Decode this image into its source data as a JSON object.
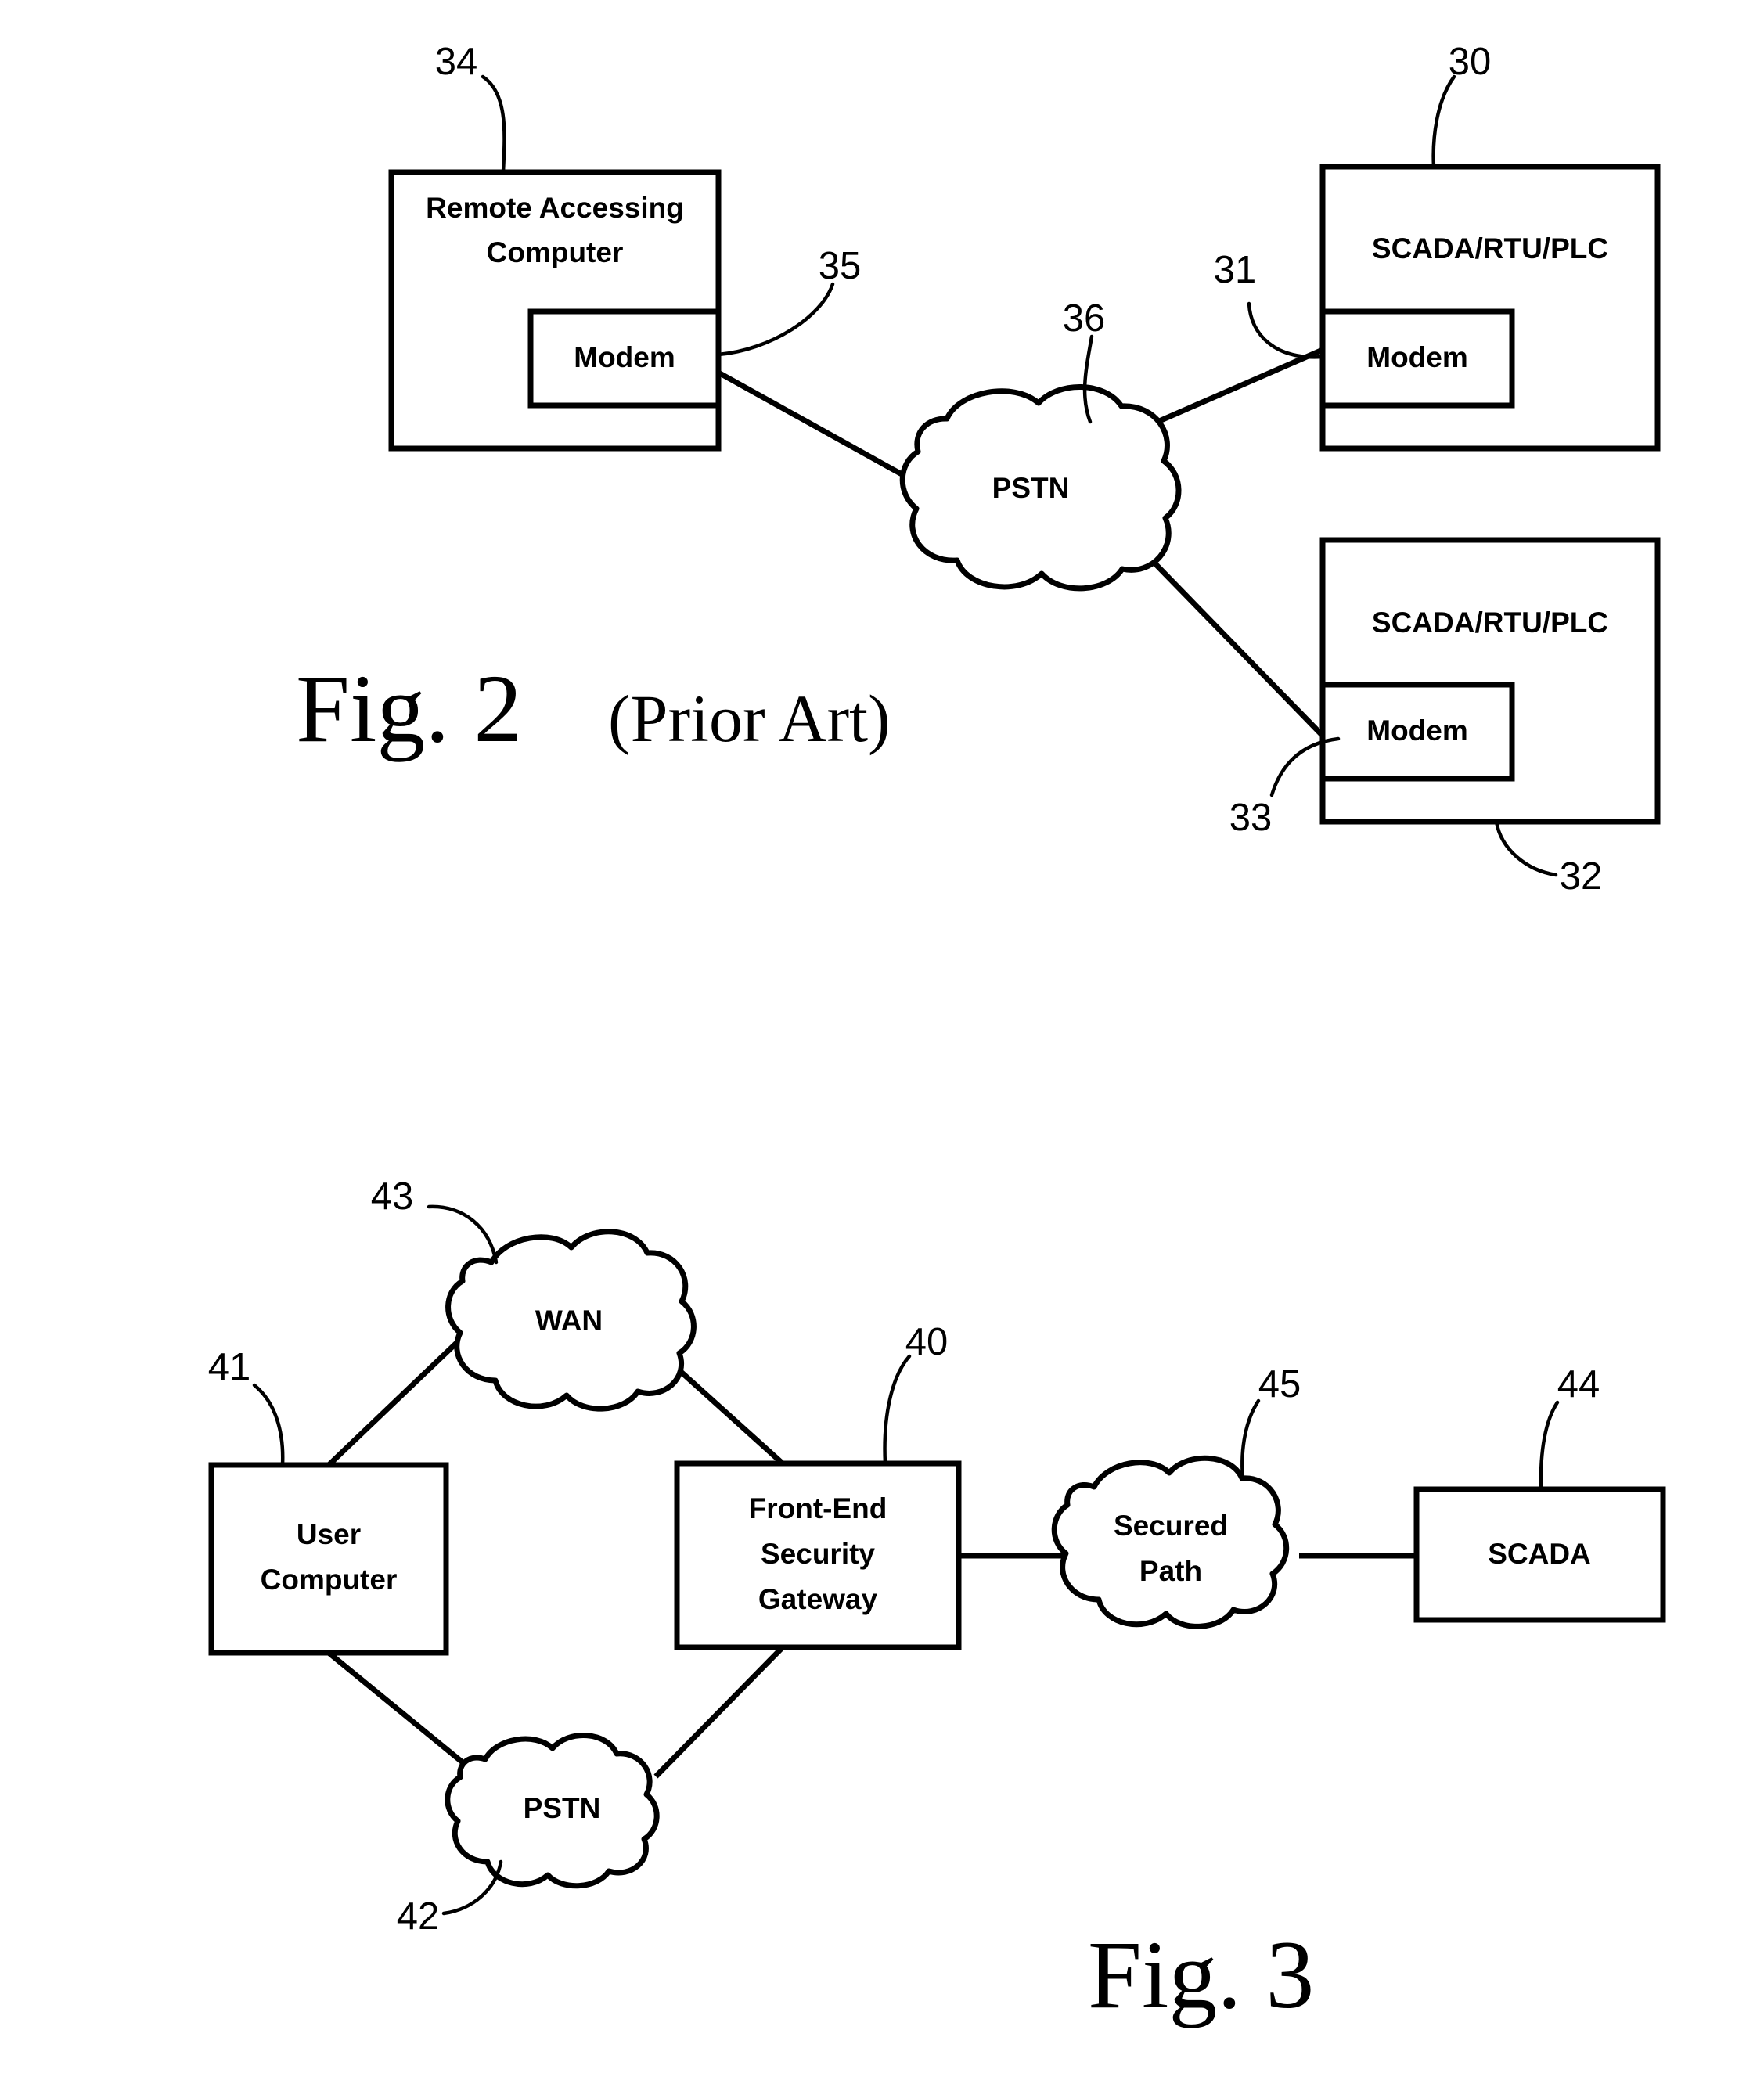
{
  "page": {
    "background": "#ffffff",
    "ink": "#000000"
  },
  "figures": [
    {
      "id": "fig2",
      "caption_main": "Fig. 2",
      "caption_sub": "(Prior Art)",
      "nodes": [
        {
          "id": "remote-accessing-computer",
          "label_line1": "Remote Accessing",
          "label_line2": "Computer",
          "ref": "34",
          "shape": "box"
        },
        {
          "id": "remote-modem",
          "label": "Modem",
          "ref": "35",
          "shape": "box"
        },
        {
          "id": "pstn-cloud",
          "label": "PSTN",
          "ref": "36",
          "shape": "cloud"
        },
        {
          "id": "scada-rtu-plc-upper",
          "label": "SCADA/RTU/PLC",
          "ref": "30",
          "shape": "box"
        },
        {
          "id": "scada-upper-modem",
          "label": "Modem",
          "ref": "31",
          "shape": "box"
        },
        {
          "id": "scada-rtu-plc-lower",
          "label": "SCADA/RTU/PLC",
          "ref": "32",
          "shape": "box"
        },
        {
          "id": "scada-lower-modem",
          "label": "Modem",
          "ref": "33",
          "shape": "box"
        }
      ]
    },
    {
      "id": "fig3",
      "caption_main": "Fig. 3",
      "caption_sub": "",
      "nodes": [
        {
          "id": "wan-cloud",
          "label": "WAN",
          "ref": "43",
          "shape": "cloud"
        },
        {
          "id": "user-computer",
          "label_line1": "User",
          "label_line2": "Computer",
          "ref": "41",
          "shape": "box"
        },
        {
          "id": "front-end-security-gateway",
          "label_line1": "Front-End",
          "label_line2": "Security",
          "label_line3": "Gateway",
          "ref": "40",
          "shape": "box"
        },
        {
          "id": "pstn-cloud-fig3",
          "label": "PSTN",
          "ref": "42",
          "shape": "cloud"
        },
        {
          "id": "secured-path-cloud",
          "label_line1": "Secured",
          "label_line2": "Path",
          "ref": "45",
          "shape": "cloud"
        },
        {
          "id": "scada",
          "label": "SCADA",
          "ref": "44",
          "shape": "box"
        }
      ]
    }
  ],
  "fig2": {
    "remote_computer": {
      "line1": "Remote Accessing",
      "line2": "Computer"
    },
    "remote_modem": "Modem",
    "pstn": "PSTN",
    "scada_upper": "SCADA/RTU/PLC",
    "scada_upper_modem": "Modem",
    "scada_lower": "SCADA/RTU/PLC",
    "scada_lower_modem": "Modem",
    "refs": {
      "r34": "34",
      "r35": "35",
      "r36": "36",
      "r30": "30",
      "r31": "31",
      "r32": "32",
      "r33": "33"
    },
    "caption_main": "Fig. 2",
    "caption_sub": "(Prior Art)"
  },
  "fig3": {
    "wan": "WAN",
    "user_computer": {
      "line1": "User",
      "line2": "Computer"
    },
    "gateway": {
      "line1": "Front-End",
      "line2": "Security",
      "line3": "Gateway"
    },
    "pstn": "PSTN",
    "secured_path": {
      "line1": "Secured",
      "line2": "Path"
    },
    "scada": "SCADA",
    "refs": {
      "r43": "43",
      "r41": "41",
      "r40": "40",
      "r42": "42",
      "r45": "45",
      "r44": "44"
    },
    "caption_main": "Fig. 3",
    "caption_sub": ""
  }
}
